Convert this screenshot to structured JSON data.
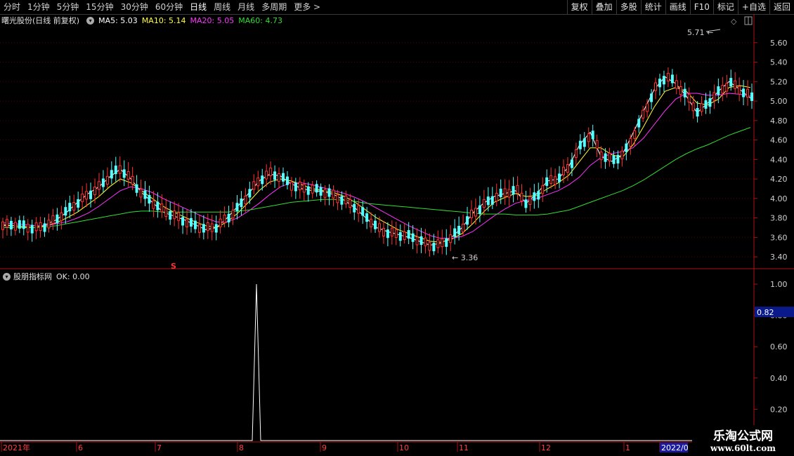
{
  "toolbar": {
    "tabs": [
      "分时",
      "1分钟",
      "5分钟",
      "15分钟",
      "30分钟",
      "60分钟",
      "日线",
      "周线",
      "月线",
      "多周期",
      "更多 >"
    ],
    "active_tab": "日线",
    "tools": [
      "复权",
      "叠加",
      "多股",
      "统计",
      "画线",
      "F10",
      "标记",
      "+自选",
      "返回"
    ]
  },
  "main_panel": {
    "stock_title": "曙光股份(日线 前复权)",
    "ma": [
      {
        "label": "MA5: 5.03",
        "color": "#ffffff"
      },
      {
        "label": "MA10: 5.14",
        "color": "#ffff33"
      },
      {
        "label": "MA20: 5.05",
        "color": "#ff33ff"
      },
      {
        "label": "MA60: 4.73",
        "color": "#33dd33"
      }
    ],
    "y_ticks": [
      "5.60",
      "5.40",
      "5.20",
      "5.00",
      "4.80",
      "4.60",
      "4.40",
      "4.20",
      "4.00",
      "3.80",
      "3.60",
      "3.40"
    ],
    "y_min": 3.3,
    "y_max": 5.75,
    "high_label": "5.71",
    "low_label": "3.36",
    "marker": "S"
  },
  "indicator_panel": {
    "title": "股朋指标网",
    "value": "OK: 0.00",
    "y_ticks": [
      "1.00",
      "0.80",
      "0.60",
      "0.40",
      "0.20"
    ],
    "cursor_value": "0.82",
    "signal_value": 1.0
  },
  "x_axis": {
    "labels": [
      "2021年",
      "6",
      "7",
      "8",
      "9",
      "10",
      "11",
      "12",
      "1",
      "2022/0"
    ]
  },
  "watermark": {
    "title": "乐淘公式网",
    "url": "www.60lt.com"
  },
  "colors": {
    "up": "#ff3232",
    "down": "#54ffff",
    "ma5": "#ffffff",
    "ma10": "#ffff33",
    "ma20": "#ff33ff",
    "ma60": "#33dd33",
    "axis": "#b01010"
  },
  "chart_data": {
    "type": "line",
    "title": "曙光股份(日线 前复权)",
    "series": [
      {
        "name": "MA5",
        "values": [
          3.72,
          3.72,
          3.71,
          3.7,
          3.73,
          3.78,
          3.86,
          3.96,
          4.05,
          4.12,
          4.22,
          4.3,
          4.2,
          4.06,
          3.96,
          3.86,
          3.82,
          3.78,
          3.73,
          3.68,
          3.7,
          3.8,
          3.92,
          4.05,
          4.18,
          4.25,
          4.23,
          4.15,
          4.1,
          4.08,
          4.07,
          4.04,
          3.98,
          3.9,
          3.8,
          3.7,
          3.66,
          3.63,
          3.6,
          3.56,
          3.52,
          3.54,
          3.6,
          3.7,
          3.85,
          3.95,
          4.02,
          4.05,
          4.08,
          3.95,
          4.05,
          4.18,
          4.2,
          4.33,
          4.55,
          4.68,
          4.43,
          4.38,
          4.45,
          4.67,
          4.9,
          5.12,
          5.25,
          5.18,
          5.05,
          4.88,
          4.98,
          5.1,
          5.2,
          5.12,
          5.03
        ]
      },
      {
        "name": "MA10",
        "values": [
          3.73,
          3.72,
          3.71,
          3.7,
          3.72,
          3.75,
          3.8,
          3.86,
          3.94,
          4.02,
          4.12,
          4.2,
          4.16,
          4.08,
          4.0,
          3.92,
          3.86,
          3.81,
          3.76,
          3.72,
          3.7,
          3.76,
          3.85,
          3.96,
          4.08,
          4.17,
          4.2,
          4.18,
          4.14,
          4.1,
          4.08,
          4.06,
          4.02,
          3.96,
          3.88,
          3.8,
          3.74,
          3.68,
          3.64,
          3.6,
          3.56,
          3.55,
          3.58,
          3.64,
          3.74,
          3.86,
          3.96,
          4.01,
          4.05,
          4.02,
          4.03,
          4.1,
          4.16,
          4.24,
          4.38,
          4.52,
          4.52,
          4.45,
          4.42,
          4.55,
          4.74,
          4.94,
          5.1,
          5.14,
          5.1,
          4.98,
          4.96,
          5.02,
          5.14,
          5.16,
          5.14
        ]
      },
      {
        "name": "MA20",
        "values": [
          3.75,
          3.74,
          3.73,
          3.72,
          3.72,
          3.74,
          3.76,
          3.8,
          3.85,
          3.92,
          4.0,
          4.08,
          4.12,
          4.1,
          4.06,
          4.0,
          3.95,
          3.9,
          3.85,
          3.8,
          3.76,
          3.76,
          3.8,
          3.87,
          3.95,
          4.04,
          4.12,
          4.16,
          4.16,
          4.14,
          4.11,
          4.08,
          4.05,
          4.01,
          3.96,
          3.9,
          3.84,
          3.78,
          3.72,
          3.67,
          3.62,
          3.59,
          3.59,
          3.61,
          3.66,
          3.74,
          3.82,
          3.89,
          3.95,
          3.98,
          4.0,
          4.04,
          4.08,
          4.14,
          4.22,
          4.34,
          4.42,
          4.46,
          4.48,
          4.52,
          4.62,
          4.76,
          4.9,
          5.02,
          5.08,
          5.08,
          5.06,
          5.06,
          5.08,
          5.07,
          5.05
        ]
      },
      {
        "name": "MA60",
        "values": [
          3.7,
          3.7,
          3.7,
          3.7,
          3.71,
          3.72,
          3.74,
          3.76,
          3.78,
          3.8,
          3.82,
          3.84,
          3.86,
          3.87,
          3.87,
          3.86,
          3.86,
          3.86,
          3.86,
          3.86,
          3.86,
          3.86,
          3.87,
          3.88,
          3.9,
          3.92,
          3.94,
          3.96,
          3.97,
          3.98,
          3.99,
          3.99,
          3.98,
          3.97,
          3.95,
          3.94,
          3.93,
          3.92,
          3.91,
          3.9,
          3.89,
          3.88,
          3.87,
          3.86,
          3.85,
          3.84,
          3.84,
          3.84,
          3.83,
          3.83,
          3.83,
          3.84,
          3.86,
          3.88,
          3.92,
          3.96,
          4.0,
          4.04,
          4.08,
          4.13,
          4.19,
          4.26,
          4.33,
          4.4,
          4.46,
          4.51,
          4.55,
          4.6,
          4.65,
          4.69,
          4.73
        ]
      }
    ],
    "ylim": [
      3.3,
      5.75
    ]
  }
}
